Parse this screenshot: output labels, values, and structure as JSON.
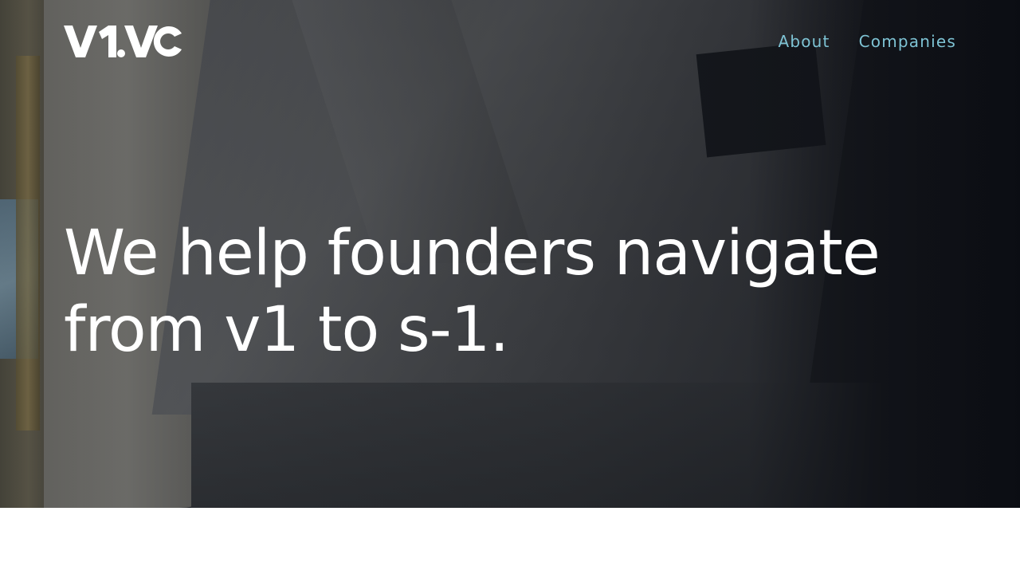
{
  "brand": {
    "logo_text": "V1.VC",
    "logo_color": "#ffffff"
  },
  "nav": {
    "items": [
      {
        "label": "About"
      },
      {
        "label": "Companies"
      }
    ],
    "link_color": "#7ec3d4"
  },
  "hero": {
    "headline_line1": "We help founders navigate",
    "headline_line2": "from v1 to s-1."
  }
}
